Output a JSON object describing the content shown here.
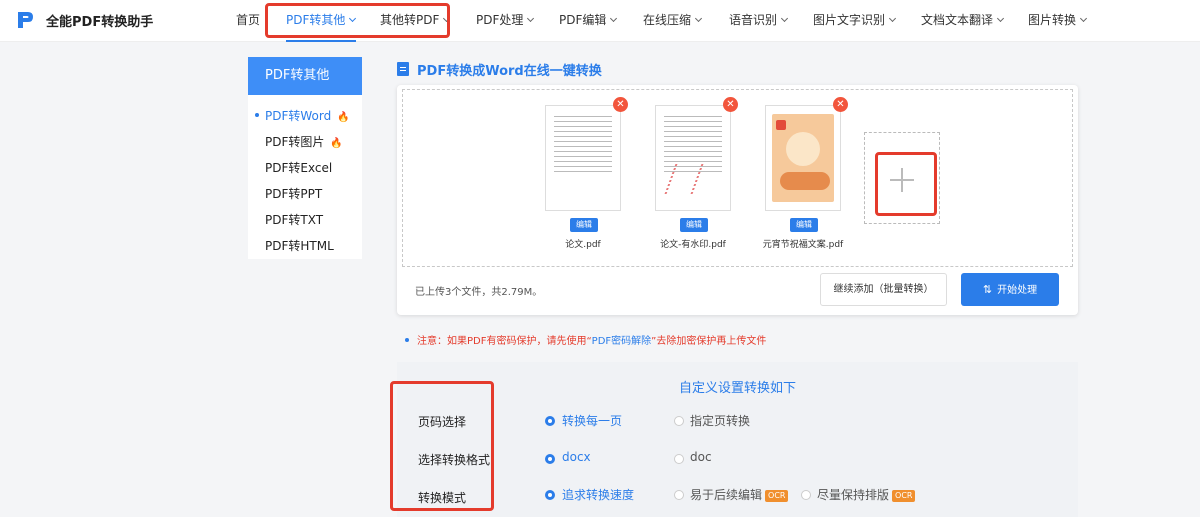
{
  "app": {
    "title": "全能PDF转换助手",
    "brand_color": "#2b7de9"
  },
  "nav": [
    {
      "label": "首页"
    },
    {
      "label": "PDF转其他"
    },
    {
      "label": "其他转PDF"
    },
    {
      "label": "PDF处理"
    },
    {
      "label": "PDF编辑"
    },
    {
      "label": "在线压缩"
    },
    {
      "label": "语音识别"
    },
    {
      "label": "图片文字识别"
    },
    {
      "label": "文档文本翻译"
    },
    {
      "label": "图片转换"
    }
  ],
  "sidebar": {
    "title": "PDF转其他",
    "items": [
      {
        "label": "PDF转Word",
        "hot": true
      },
      {
        "label": "PDF转图片",
        "hot": true
      },
      {
        "label": "PDF转Excel"
      },
      {
        "label": "PDF转PPT"
      },
      {
        "label": "PDF转TXT"
      },
      {
        "label": "PDF转HTML"
      }
    ]
  },
  "main": {
    "title": "PDF转换成Word在线一键转换"
  },
  "files": [
    {
      "name": "论文.pdf",
      "edit_label": "编辑"
    },
    {
      "name": "论文-有水印.pdf",
      "edit_label": "编辑"
    },
    {
      "name": "元宵节祝福文案.pdf",
      "edit_label": "编辑"
    }
  ],
  "upload": {
    "info": "已上传3个文件，共2.79M。",
    "continue_label": "继续添加（批量转换）",
    "start_label": "开始处理"
  },
  "notice": {
    "prefix": "注意：如果PDF有密码保护，请先使用“",
    "link": "PDF密码解除",
    "suffix": "”去除加密保护再上传文件"
  },
  "settings": {
    "title": "自定义设置转换如下",
    "rows": [
      {
        "label": "页码选择",
        "options": [
          "转换每一页",
          "指定页转换"
        ]
      },
      {
        "label": "选择转换格式",
        "options": [
          "docx",
          "doc"
        ]
      },
      {
        "label": "转换模式",
        "options": [
          "追求转换速度",
          "易于后续编辑",
          "尽量保持排版"
        ],
        "badge": "OCR"
      }
    ]
  }
}
